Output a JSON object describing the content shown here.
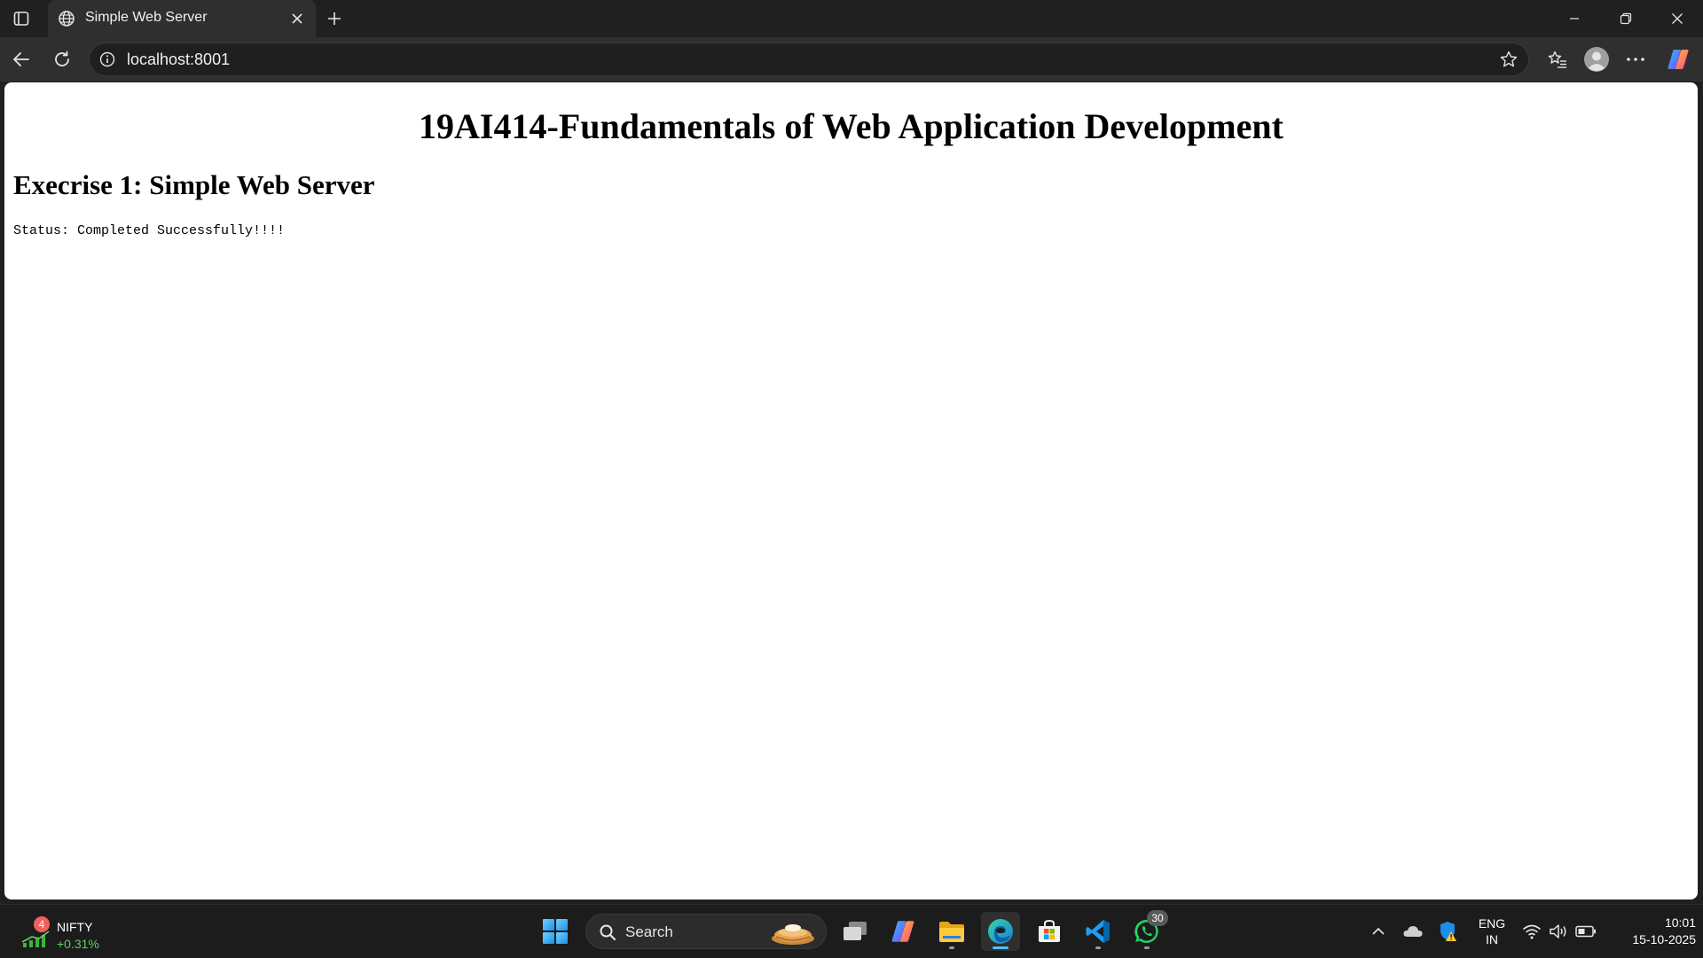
{
  "browser": {
    "tab": {
      "title": "Simple Web Server"
    },
    "address_bar": {
      "url": "localhost:8001"
    }
  },
  "page": {
    "heading": "19AI414-Fundamentals of Web Application Development",
    "subheading": "Execrise 1: Simple Web Server",
    "status_text": "Status: Completed Successfully!!!!"
  },
  "taskbar": {
    "widget": {
      "name": "NIFTY",
      "change": "+0.31%",
      "badge": "4"
    },
    "search_label": "Search",
    "pinned_apps": [
      "task-view",
      "copilot",
      "file-explorer",
      "edge",
      "microsoft-store",
      "vscode",
      "whatsapp"
    ],
    "whatsapp_badge": "30",
    "language": {
      "line1": "ENG",
      "line2": "IN"
    },
    "clock": {
      "time": "10:01",
      "date": "15-10-2025"
    }
  },
  "colors": {
    "chrome_dark": "#202020",
    "toolbar": "#2f2f2f",
    "page_bg": "#ffffff",
    "accent": "#4cc2ff",
    "nifty_up": "#5fd35f"
  }
}
